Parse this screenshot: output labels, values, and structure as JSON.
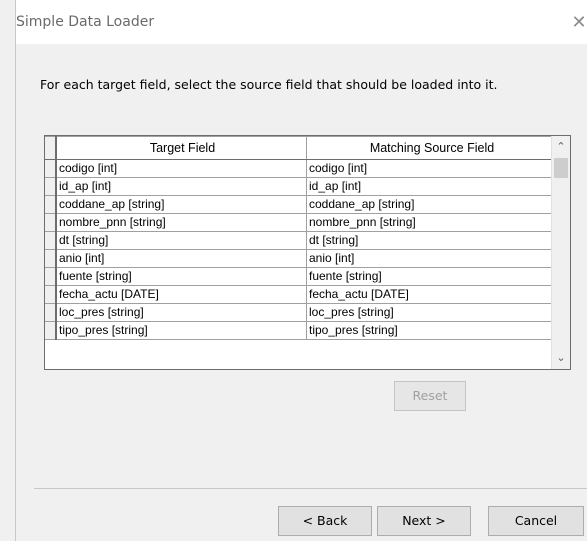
{
  "window": {
    "title": "Simple Data Loader",
    "close_glyph": "✕"
  },
  "instructions": "For each target field, select the source field that should be loaded into it.",
  "grid": {
    "columns": [
      "Target Field",
      "Matching Source Field"
    ],
    "rows": [
      {
        "target": "codigo [int]",
        "source": "codigo [int]"
      },
      {
        "target": "id_ap [int]",
        "source": "id_ap [int]"
      },
      {
        "target": "coddane_ap [string]",
        "source": "coddane_ap [string]"
      },
      {
        "target": "nombre_pnn [string]",
        "source": "nombre_pnn [string]"
      },
      {
        "target": "dt [string]",
        "source": "dt [string]"
      },
      {
        "target": "anio [int]",
        "source": "anio [int]"
      },
      {
        "target": "fuente [string]",
        "source": "fuente [string]"
      },
      {
        "target": "fecha_actu [DATE]",
        "source": "fecha_actu [DATE]"
      },
      {
        "target": "loc_pres [string]",
        "source": "loc_pres [string]"
      },
      {
        "target": "tipo_pres [string]",
        "source": "tipo_pres [string]"
      }
    ],
    "scroll_up_glyph": "⌃",
    "scroll_down_glyph": "⌄"
  },
  "buttons": {
    "reset": "Reset",
    "back": "< Back",
    "next": "Next >",
    "cancel": "Cancel"
  }
}
